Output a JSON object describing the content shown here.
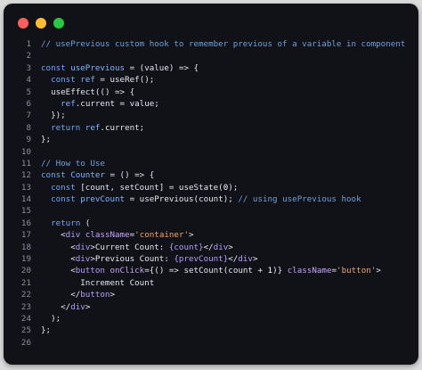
{
  "window": {
    "dots": [
      {
        "name": "close",
        "color": "#ff5f57"
      },
      {
        "name": "minimize",
        "color": "#febc2e"
      },
      {
        "name": "maximize",
        "color": "#28c840"
      }
    ]
  },
  "code": {
    "lines": [
      {
        "n": "1",
        "tokens": [
          {
            "t": "// usePrevious custom hook to remember previous of a variable in component",
            "c": "comment"
          }
        ]
      },
      {
        "n": "2",
        "tokens": []
      },
      {
        "n": "3",
        "tokens": [
          {
            "t": "const ",
            "c": "keyword"
          },
          {
            "t": "usePrevious",
            "c": "name"
          },
          {
            "t": " = (",
            "c": "punct"
          },
          {
            "t": "value",
            "c": "var"
          },
          {
            "t": ") => {",
            "c": "punct"
          }
        ]
      },
      {
        "n": "4",
        "tokens": [
          {
            "t": "  const ",
            "c": "keyword"
          },
          {
            "t": "ref",
            "c": "name"
          },
          {
            "t": " = ",
            "c": "punct"
          },
          {
            "t": "useRef",
            "c": "var"
          },
          {
            "t": "();",
            "c": "punct"
          }
        ]
      },
      {
        "n": "5",
        "tokens": [
          {
            "t": "  ",
            "c": "punct"
          },
          {
            "t": "useEffect",
            "c": "var"
          },
          {
            "t": "(() => {",
            "c": "punct"
          }
        ]
      },
      {
        "n": "6",
        "tokens": [
          {
            "t": "    ",
            "c": "punct"
          },
          {
            "t": "ref",
            "c": "name"
          },
          {
            "t": ".current = ",
            "c": "punct"
          },
          {
            "t": "value",
            "c": "var"
          },
          {
            "t": ";",
            "c": "punct"
          }
        ]
      },
      {
        "n": "7",
        "tokens": [
          {
            "t": "  });",
            "c": "punct"
          }
        ]
      },
      {
        "n": "8",
        "tokens": [
          {
            "t": "  return ",
            "c": "keyword"
          },
          {
            "t": "ref",
            "c": "name"
          },
          {
            "t": ".current;",
            "c": "punct"
          }
        ]
      },
      {
        "n": "9",
        "tokens": [
          {
            "t": "};",
            "c": "punct"
          }
        ]
      },
      {
        "n": "10",
        "tokens": []
      },
      {
        "n": "11",
        "tokens": [
          {
            "t": "// How to Use",
            "c": "comment"
          }
        ]
      },
      {
        "n": "12",
        "tokens": [
          {
            "t": "const ",
            "c": "keyword"
          },
          {
            "t": "Counter",
            "c": "name"
          },
          {
            "t": " = () => {",
            "c": "punct"
          }
        ]
      },
      {
        "n": "13",
        "tokens": [
          {
            "t": "  const ",
            "c": "keyword"
          },
          {
            "t": "[count, setCount] = ",
            "c": "punct"
          },
          {
            "t": "useState",
            "c": "var"
          },
          {
            "t": "(",
            "c": "punct"
          },
          {
            "t": "0",
            "c": "number"
          },
          {
            "t": ");",
            "c": "punct"
          }
        ]
      },
      {
        "n": "14",
        "tokens": [
          {
            "t": "  const ",
            "c": "keyword"
          },
          {
            "t": "prevCount",
            "c": "name"
          },
          {
            "t": " = ",
            "c": "punct"
          },
          {
            "t": "usePrevious",
            "c": "var"
          },
          {
            "t": "(count); ",
            "c": "punct"
          },
          {
            "t": "// using usePrevious hook",
            "c": "comment"
          }
        ]
      },
      {
        "n": "15",
        "tokens": []
      },
      {
        "n": "16",
        "tokens": [
          {
            "t": "  return ",
            "c": "keyword"
          },
          {
            "t": "(",
            "c": "punct"
          }
        ]
      },
      {
        "n": "17",
        "tokens": [
          {
            "t": "    <",
            "c": "punct"
          },
          {
            "t": "div",
            "c": "tag"
          },
          {
            "t": " ",
            "c": "punct"
          },
          {
            "t": "className",
            "c": "attr"
          },
          {
            "t": "=",
            "c": "punct"
          },
          {
            "t": "'container'",
            "c": "string"
          },
          {
            "t": ">",
            "c": "punct"
          }
        ]
      },
      {
        "n": "18",
        "tokens": [
          {
            "t": "      <",
            "c": "punct"
          },
          {
            "t": "div",
            "c": "tag"
          },
          {
            "t": ">Current Count: ",
            "c": "punct"
          },
          {
            "t": "{count}",
            "c": "tag"
          },
          {
            "t": "</",
            "c": "punct"
          },
          {
            "t": "div",
            "c": "tag"
          },
          {
            "t": ">",
            "c": "punct"
          }
        ]
      },
      {
        "n": "19",
        "tokens": [
          {
            "t": "      <",
            "c": "punct"
          },
          {
            "t": "div",
            "c": "tag"
          },
          {
            "t": ">Previous Count: ",
            "c": "punct"
          },
          {
            "t": "{prevCount}",
            "c": "tag"
          },
          {
            "t": "</",
            "c": "punct"
          },
          {
            "t": "div",
            "c": "tag"
          },
          {
            "t": ">",
            "c": "punct"
          }
        ]
      },
      {
        "n": "20",
        "tokens": [
          {
            "t": "      <",
            "c": "punct"
          },
          {
            "t": "button",
            "c": "tag"
          },
          {
            "t": " ",
            "c": "punct"
          },
          {
            "t": "onClick",
            "c": "attr"
          },
          {
            "t": "={() => ",
            "c": "punct"
          },
          {
            "t": "setCount",
            "c": "var"
          },
          {
            "t": "(count + ",
            "c": "punct"
          },
          {
            "t": "1",
            "c": "number"
          },
          {
            "t": ")} ",
            "c": "punct"
          },
          {
            "t": "className",
            "c": "attr"
          },
          {
            "t": "=",
            "c": "punct"
          },
          {
            "t": "'button'",
            "c": "string"
          },
          {
            "t": ">",
            "c": "punct"
          }
        ]
      },
      {
        "n": "21",
        "tokens": [
          {
            "t": "        Increment Count",
            "c": "punct"
          }
        ]
      },
      {
        "n": "22",
        "tokens": [
          {
            "t": "      </",
            "c": "punct"
          },
          {
            "t": "button",
            "c": "tag"
          },
          {
            "t": ">",
            "c": "punct"
          }
        ]
      },
      {
        "n": "23",
        "tokens": [
          {
            "t": "    </",
            "c": "punct"
          },
          {
            "t": "div",
            "c": "tag"
          },
          {
            "t": ">",
            "c": "punct"
          }
        ]
      },
      {
        "n": "24",
        "tokens": [
          {
            "t": "  );",
            "c": "punct"
          }
        ]
      },
      {
        "n": "25",
        "tokens": [
          {
            "t": "};",
            "c": "punct"
          }
        ]
      },
      {
        "n": "26",
        "tokens": []
      }
    ]
  }
}
